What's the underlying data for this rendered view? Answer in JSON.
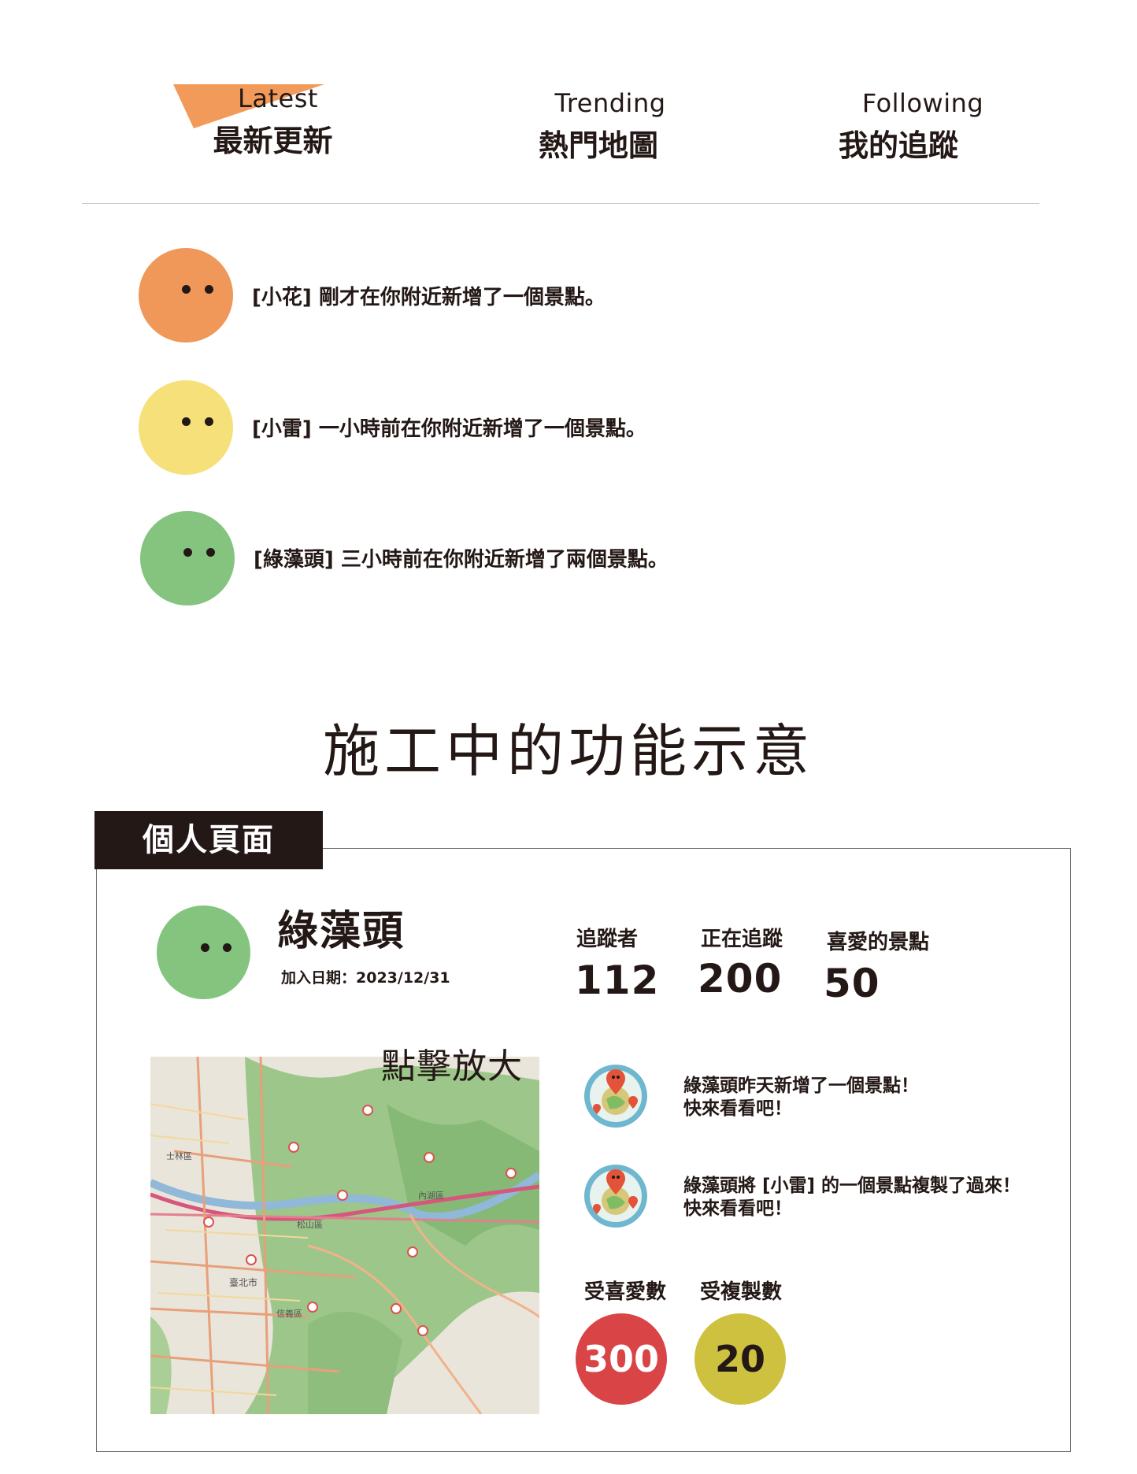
{
  "tabs": [
    {
      "en": "Latest",
      "zh": "最新更新",
      "active": true
    },
    {
      "en": "Trending",
      "zh": "熱門地圖",
      "active": false
    },
    {
      "en": "Following",
      "zh": "我的追蹤",
      "active": false
    }
  ],
  "colors": {
    "accent": "#f19a5a",
    "orange": "#f0975a",
    "yellow": "#f5e07a",
    "green": "#84c47f",
    "dark": "#231815",
    "red": "#d94446",
    "olive": "#cec13f"
  },
  "feed": [
    {
      "text": "[小花] 剛才在你附近新增了一個景點。",
      "avatar_color": "orange"
    },
    {
      "text": "[小雷] 一小時前在你附近新增了一個景點。",
      "avatar_color": "yellow"
    },
    {
      "text": "[綠藻頭] 三小時前在你附近新增了兩個景點。",
      "avatar_color": "green"
    }
  ],
  "section_title": "施工中的功能示意",
  "profile": {
    "tab_label": "個人頁面",
    "name": "綠藻頭",
    "join_date": "加入日期：2023/12/31",
    "stats": [
      {
        "label": "追蹤者",
        "value": "112"
      },
      {
        "label": "正在追蹤",
        "value": "200"
      },
      {
        "label": "喜愛的景點",
        "value": "50"
      }
    ],
    "map_caption": "點擊放大",
    "map_labels": [
      "臺北市",
      "松山區",
      "信義區",
      "士林區",
      "內湖區"
    ],
    "activities": [
      {
        "line1": "綠藻頭昨天新增了一個景點！",
        "line2": "快來看看吧！",
        "icon": "map-pin-globe-icon"
      },
      {
        "line1": "綠藻頭將 [小雷] 的一個景點複製了過來！",
        "line2": "快來看看吧！",
        "icon": "map-pin-globe-icon"
      }
    ],
    "counts": [
      {
        "label": "受喜愛數",
        "value": "300"
      },
      {
        "label": "受複製數",
        "value": "20"
      }
    ]
  }
}
